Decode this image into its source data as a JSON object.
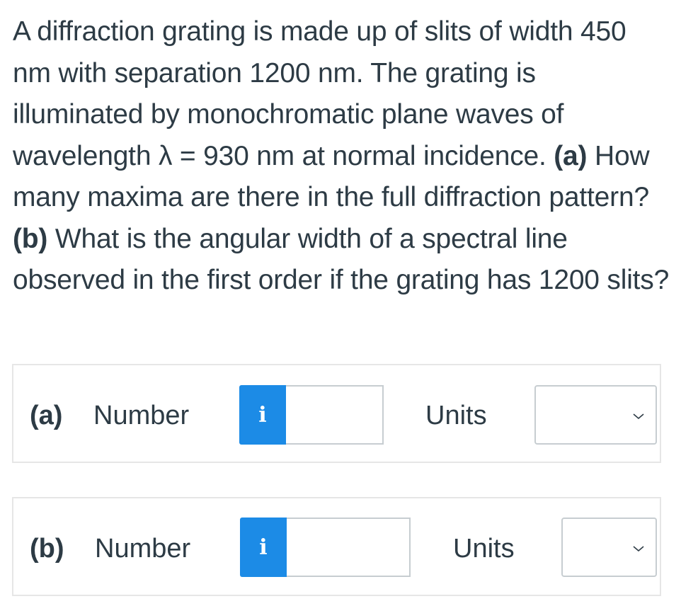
{
  "question": {
    "text_1": "A diffraction grating is made up of slits of width 450 nm with separation 1200 nm. The grating is illuminated by monochromatic plane waves of wavelength λ = 930 nm at normal incidence.",
    "part_a_marker": "(a)",
    "text_2": "How many maxima are there in the full diffraction pattern?",
    "part_b_marker": "(b)",
    "text_3": "What is the angular width of a spectral line observed in the first order if the grating has 1200 slits?"
  },
  "answers": [
    {
      "part": "(a)",
      "number_label": "Number",
      "info_icon": "i",
      "value": "",
      "units_label": "Units",
      "units_value": ""
    },
    {
      "part": "(b)",
      "number_label": "Number",
      "info_icon": "i",
      "value": "",
      "units_label": "Units",
      "units_value": ""
    }
  ],
  "colors": {
    "info_button": "#1c8be6",
    "text": "#2d3b45",
    "border": "#c7cdd1"
  },
  "icons": {
    "info": "info-icon",
    "dropdown": "chevron-down-icon"
  }
}
